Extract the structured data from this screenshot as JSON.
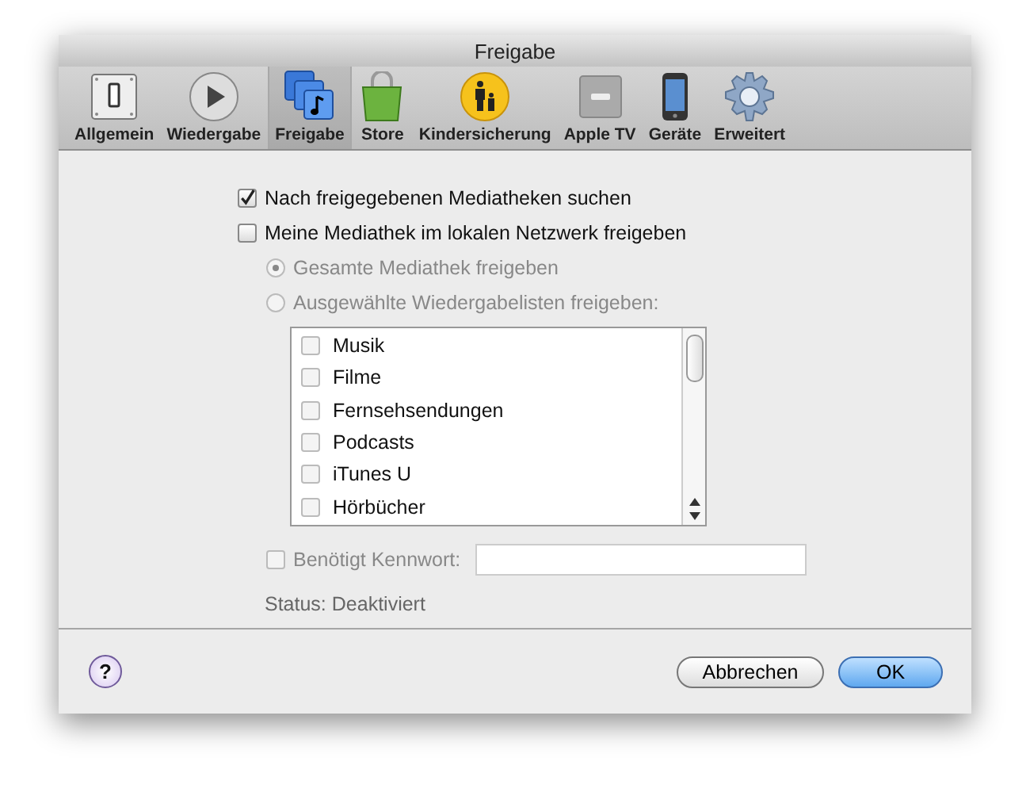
{
  "window": {
    "title": "Freigabe"
  },
  "toolbar": [
    {
      "label": "Allgemein",
      "kind": "switch",
      "selected": false
    },
    {
      "label": "Wiedergabe",
      "kind": "play",
      "selected": false
    },
    {
      "label": "Freigabe",
      "kind": "music",
      "selected": true
    },
    {
      "label": "Store",
      "kind": "bag",
      "selected": false
    },
    {
      "label": "Kindersicherung",
      "kind": "parent",
      "selected": false
    },
    {
      "label": "Apple TV",
      "kind": "tv",
      "selected": false
    },
    {
      "label": "Geräte",
      "kind": "phone",
      "selected": false
    },
    {
      "label": "Erweitert",
      "kind": "gear",
      "selected": false
    }
  ],
  "options": [
    {
      "label": "Nach freigegebenen Mediatheken suchen",
      "checked": true
    },
    {
      "label": "Meine Mediathek im lokalen Netzwerk freigeben",
      "checked": false
    }
  ],
  "share_mode": {
    "disabled": true,
    "choices": [
      {
        "label": "Gesamte Mediathek freigeben",
        "selected": true
      },
      {
        "label": "Ausgewählte Wiedergabelisten freigeben:",
        "selected": false
      }
    ]
  },
  "playlists": [
    {
      "label": "Musik",
      "checked": false
    },
    {
      "label": "Filme",
      "checked": false
    },
    {
      "label": "Fernsehsendungen",
      "checked": false
    },
    {
      "label": "Podcasts",
      "checked": false
    },
    {
      "label": "iTunes U",
      "checked": false
    },
    {
      "label": "Hörbücher",
      "checked": false
    }
  ],
  "password": {
    "label": "Benötigt Kennwort:",
    "checked": false,
    "disabled": true
  },
  "status": "Status: Deaktiviert",
  "help": "?",
  "buttons": [
    {
      "label": "Abbrechen",
      "kind": "cancel"
    },
    {
      "label": "OK",
      "kind": "default"
    }
  ]
}
